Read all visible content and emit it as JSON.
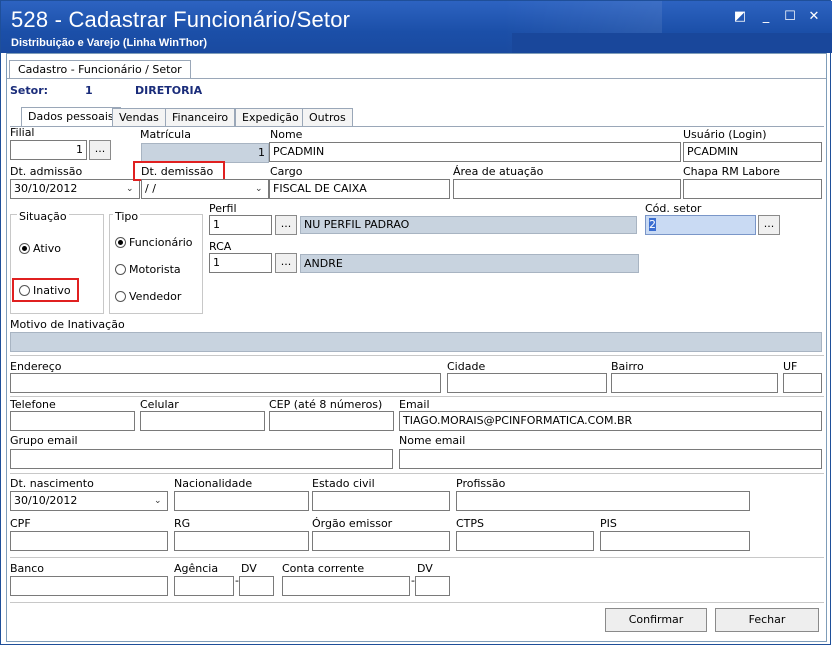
{
  "window": {
    "title": "528 - Cadastrar Funcionário/Setor",
    "subtitle": "Distribuição e Varejo (Linha WinThor)",
    "controls": [
      "◩",
      "_",
      "☐",
      "✕"
    ]
  },
  "outer_tab": "Cadastro - Funcionário / Setor",
  "setor": {
    "label": "Setor:",
    "code": "1",
    "name": "DIRETORIA"
  },
  "tabs": [
    "Dados pessoais",
    "Vendas",
    "Financeiro",
    "Expedição",
    "Outros"
  ],
  "fields": {
    "filial": {
      "label": "Filial",
      "value": "1"
    },
    "matricula": {
      "label": "Matrícula",
      "value": "1"
    },
    "nome": {
      "label": "Nome",
      "value": "PCADMIN"
    },
    "usuario": {
      "label": "Usuário (Login)",
      "value": "PCADMIN"
    },
    "dt_admissao": {
      "label": "Dt. admissão",
      "value": "30/10/2012"
    },
    "dt_demissao": {
      "label": "Dt.  demissão",
      "value": " / /"
    },
    "cargo": {
      "label": "Cargo",
      "value": "FISCAL DE CAIXA"
    },
    "area_atuacao": {
      "label": "Área de atuação",
      "value": ""
    },
    "chapa": {
      "label": "Chapa RM Labore",
      "value": ""
    },
    "perfil": {
      "label": "Perfil",
      "code": "1",
      "desc": "NU  PERFIL PADRAO"
    },
    "cod_setor": {
      "label": "Cód. setor",
      "value": "2"
    },
    "rca": {
      "label": "RCA",
      "code": "1",
      "desc": "ANDRE"
    },
    "motivo_inativacao": {
      "label": "Motivo de Inativação",
      "value": ""
    },
    "endereco": {
      "label": "Endereço",
      "value": ""
    },
    "cidade": {
      "label": "Cidade",
      "value": ""
    },
    "bairro": {
      "label": "Bairro",
      "value": ""
    },
    "uf": {
      "label": "UF",
      "value": ""
    },
    "telefone": {
      "label": "Telefone",
      "value": ""
    },
    "celular": {
      "label": "Celular",
      "value": ""
    },
    "cep": {
      "label": "CEP (até 8 números)",
      "value": ""
    },
    "email": {
      "label": "Email",
      "value": "TIAGO.MORAIS@PCINFORMATICA.COM.BR"
    },
    "grupo_email": {
      "label": "Grupo email",
      "value": ""
    },
    "nome_email": {
      "label": "Nome email",
      "value": ""
    },
    "dt_nascimento": {
      "label": "Dt. nascimento",
      "value": "30/10/2012"
    },
    "nacionalidade": {
      "label": "Nacionalidade",
      "value": ""
    },
    "estado_civil": {
      "label": "Estado civil",
      "value": ""
    },
    "profissao": {
      "label": "Profissão",
      "value": ""
    },
    "cpf": {
      "label": "CPF",
      "value": ""
    },
    "rg": {
      "label": "RG",
      "value": ""
    },
    "orgao_emissor": {
      "label": "Órgão emissor",
      "value": ""
    },
    "ctps": {
      "label": "CTPS",
      "value": ""
    },
    "pis": {
      "label": "PIS",
      "value": ""
    },
    "banco": {
      "label": "Banco",
      "value": ""
    },
    "agencia": {
      "label": "Agência",
      "value": ""
    },
    "dv1": {
      "label": "DV",
      "value": ""
    },
    "conta": {
      "label": "Conta corrente",
      "value": ""
    },
    "dv2": {
      "label": "DV",
      "value": ""
    }
  },
  "situacao": {
    "label": "Situação",
    "options": [
      "Ativo",
      "Inativo"
    ],
    "selected": "Ativo"
  },
  "tipo": {
    "label": "Tipo",
    "options": [
      "Funcionário",
      "Motorista",
      "Vendedor"
    ],
    "selected": "Funcionário"
  },
  "ellipsis": "...",
  "buttons": {
    "confirmar": "Confirmar",
    "fechar": "Fechar"
  }
}
